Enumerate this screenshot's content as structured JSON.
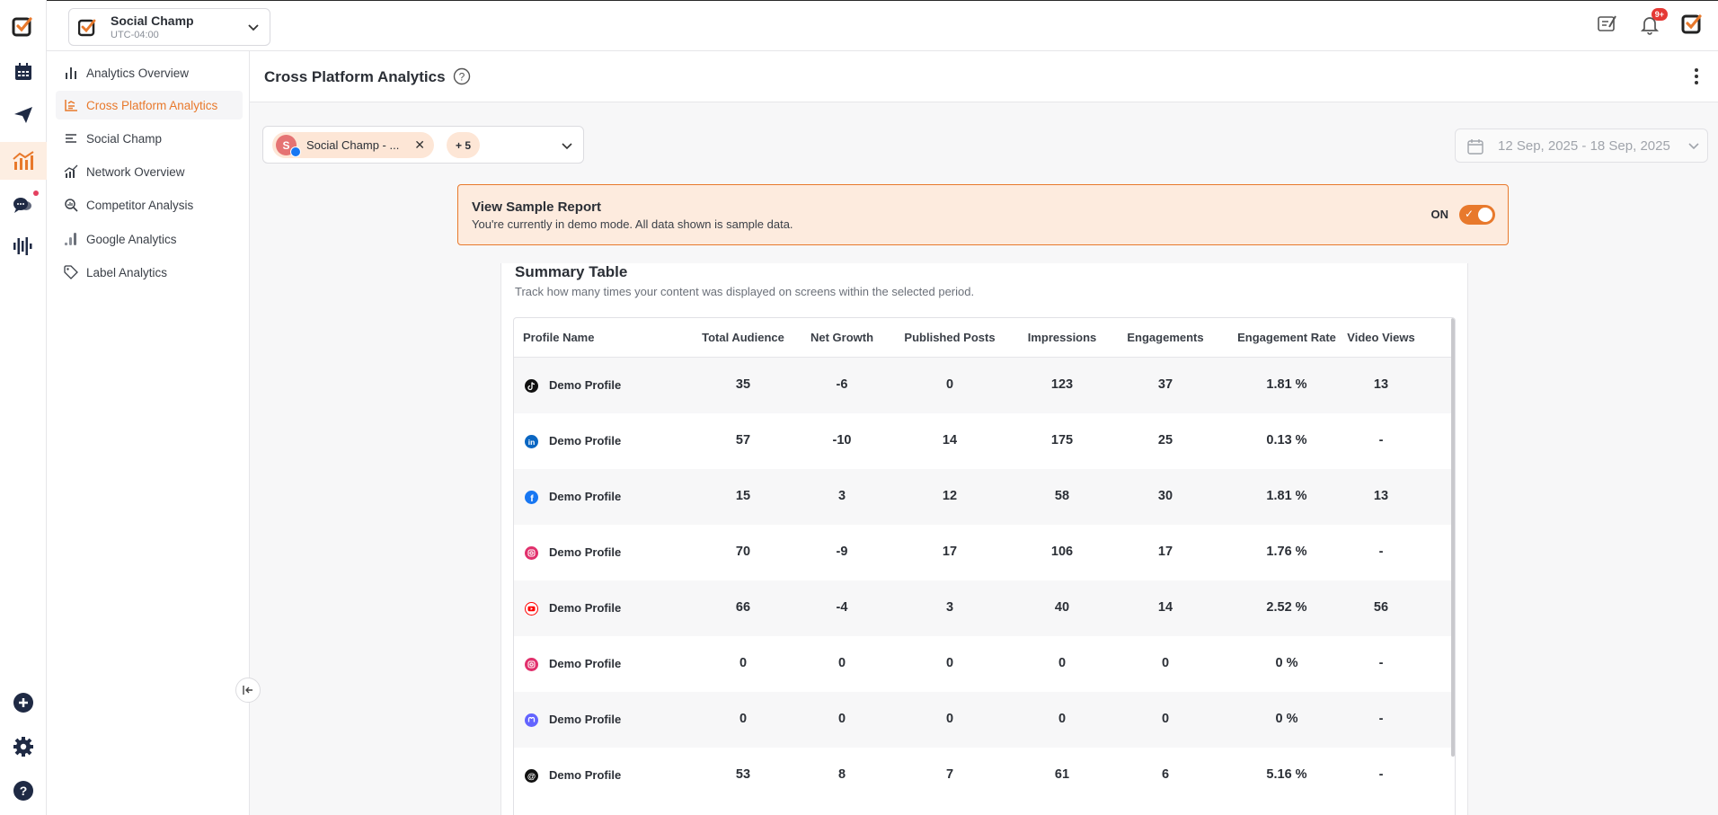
{
  "colors": {
    "accent": "#e8792c",
    "tiktok": "#111111",
    "linkedin": "#0a66c2",
    "facebook": "#1877f2",
    "instagram": "#e1306c",
    "youtube": "#ff0000",
    "mastodon": "#6364ff",
    "threads": "#111111"
  },
  "workspace": {
    "name": "Social Champ",
    "timezone": "UTC-04:00"
  },
  "topbar": {
    "notifications_badge": "9+"
  },
  "sidebar": {
    "items": [
      {
        "label": "Analytics Overview",
        "icon": "bar-chart-icon"
      },
      {
        "label": "Cross Platform Analytics",
        "icon": "line-chart-icon"
      },
      {
        "label": "Social Champ",
        "icon": "list-icon"
      },
      {
        "label": "Network Overview",
        "icon": "network-chart-icon"
      },
      {
        "label": "Competitor Analysis",
        "icon": "magnifier-chart-icon"
      },
      {
        "label": "Google Analytics",
        "icon": "google-analytics-icon"
      },
      {
        "label": "Label Analytics",
        "icon": "tag-icon"
      }
    ]
  },
  "page": {
    "title": "Cross Platform Analytics"
  },
  "filters": {
    "profile_chip": {
      "avatar_letter": "S",
      "label": "Social Champ - ..."
    },
    "more_count": "+ 5",
    "date_range": "12 Sep, 2025 - 18 Sep, 2025"
  },
  "banner": {
    "title": "View Sample Report",
    "subtitle": "You're currently in demo mode. All data shown is sample data.",
    "toggle_label": "ON",
    "toggle_on": true
  },
  "summary": {
    "title": "Summary Table",
    "subtitle": "Track how many times your content was displayed on screens within the selected period.",
    "columns": [
      "Profile Name",
      "Total Audience",
      "Net Growth",
      "Published Posts",
      "Impressions",
      "Engagements",
      "Engagement Rate",
      "Video Views"
    ],
    "rows": [
      {
        "network": "tiktok",
        "name": "Demo Profile",
        "values": [
          "35",
          "-6",
          "0",
          "123",
          "37",
          "1.81 %",
          "13"
        ]
      },
      {
        "network": "linkedin",
        "name": "Demo Profile",
        "values": [
          "57",
          "-10",
          "14",
          "175",
          "25",
          "0.13 %",
          "-"
        ]
      },
      {
        "network": "facebook",
        "name": "Demo Profile",
        "values": [
          "15",
          "3",
          "12",
          "58",
          "30",
          "1.81 %",
          "13"
        ]
      },
      {
        "network": "instagram",
        "name": "Demo Profile",
        "values": [
          "70",
          "-9",
          "17",
          "106",
          "17",
          "1.76 %",
          "-"
        ]
      },
      {
        "network": "youtube",
        "name": "Demo Profile",
        "values": [
          "66",
          "-4",
          "3",
          "40",
          "14",
          "2.52 %",
          "56"
        ]
      },
      {
        "network": "instagram",
        "name": "Demo Profile",
        "values": [
          "0",
          "0",
          "0",
          "0",
          "0",
          "0 %",
          "-"
        ]
      },
      {
        "network": "mastodon",
        "name": "Demo Profile",
        "values": [
          "0",
          "0",
          "0",
          "0",
          "0",
          "0 %",
          "-"
        ]
      },
      {
        "network": "threads",
        "name": "Demo Profile",
        "values": [
          "53",
          "8",
          "7",
          "61",
          "6",
          "5.16 %",
          "-"
        ]
      }
    ]
  }
}
